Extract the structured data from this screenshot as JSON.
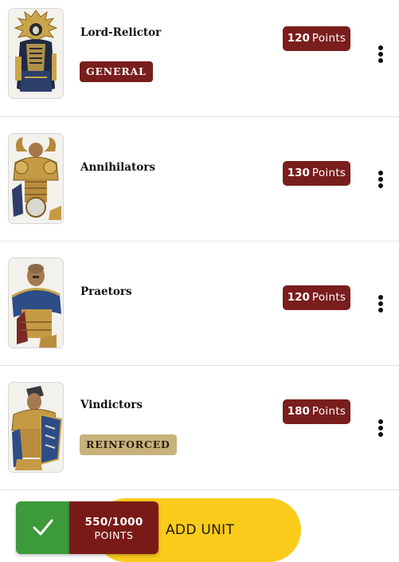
{
  "units": [
    {
      "name": "Lord-Relictor",
      "points_value": "120",
      "points_label": "Points",
      "role": "GENERAL"
    },
    {
      "name": "Annihilators",
      "points_value": "130",
      "points_label": "Points"
    },
    {
      "name": "Praetors",
      "points_value": "120",
      "points_label": "Points"
    },
    {
      "name": "Vindictors",
      "points_value": "180",
      "points_label": "Points",
      "role": "REINFORCED"
    }
  ],
  "footer": {
    "points_total": "550/1000",
    "points_unit": "POINTS",
    "add_unit_label": "ADD UNIT",
    "confirm_icon": "checkmark-icon"
  },
  "menu_icon": "vertical-ellipsis-icon",
  "colors": {
    "points_badge": "#7a1d1d",
    "general_badge": "#7a1d1d",
    "reinforced_badge": "#c8b27c",
    "add_unit": "#fbcb1b",
    "confirm": "#3d9a3a",
    "points_total": "#7a1a17"
  }
}
